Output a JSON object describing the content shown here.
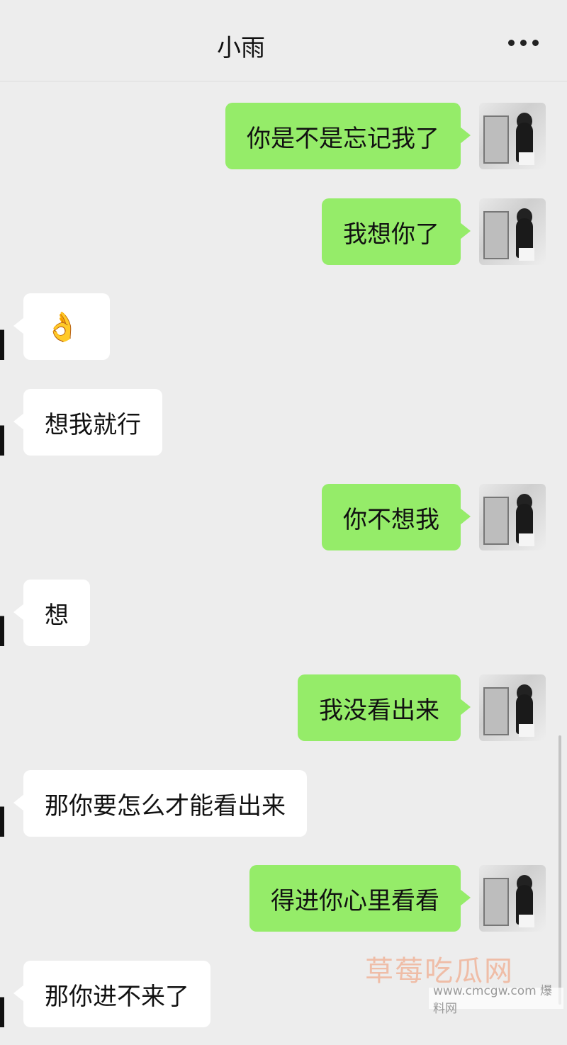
{
  "header": {
    "title": "小雨"
  },
  "messages": [
    {
      "side": "out",
      "text": "你是不是忘记我了"
    },
    {
      "side": "out",
      "text": "我想你了"
    },
    {
      "side": "in",
      "text": "👌"
    },
    {
      "side": "in",
      "text": "想我就行"
    },
    {
      "side": "out",
      "text": "你不想我"
    },
    {
      "side": "in",
      "text": "想"
    },
    {
      "side": "out",
      "text": "我没看出来"
    },
    {
      "side": "in",
      "text": "那你要怎么才能看出来"
    },
    {
      "side": "out",
      "text": "得进你心里看看"
    },
    {
      "side": "in",
      "text": "那你进不来了"
    }
  ],
  "watermark": {
    "main": "草莓吃瓜网",
    "sub": "www.cmcgw.com 爆料网"
  },
  "icons": {
    "more": "more-dots-icon",
    "avatar": "user-avatar-photo"
  }
}
